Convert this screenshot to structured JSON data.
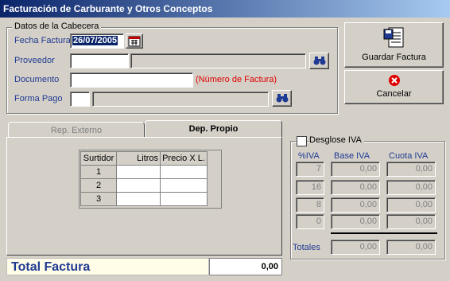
{
  "window": {
    "title": "Facturación de Carburante y Otros Conceptos"
  },
  "header": {
    "group_title": "Datos de la Cabecera",
    "fecha_label": "Fecha Factura",
    "fecha_value": "26/07/2005",
    "proveedor_label": "Proveedor",
    "proveedor_code": "",
    "proveedor_name": "",
    "documento_label": "Documento",
    "documento_value": "",
    "documento_hint": "(Número de Factura)",
    "forma_pago_label": "Forma Pago",
    "forma_pago_code": "",
    "forma_pago_name": ""
  },
  "actions": {
    "save_label": "Guardar Factura",
    "cancel_label": "Cancelar"
  },
  "tabs": [
    {
      "label": "Rep. Externo",
      "active": false
    },
    {
      "label": "Dep. Propio",
      "active": true
    }
  ],
  "surtidor_table": {
    "headers": [
      "Surtidor",
      "Litros",
      "Precio X L."
    ],
    "rows": [
      {
        "surtidor": "1",
        "litros": "",
        "precio": ""
      },
      {
        "surtidor": "2",
        "litros": "",
        "precio": ""
      },
      {
        "surtidor": "3",
        "litros": "",
        "precio": ""
      }
    ]
  },
  "iva": {
    "group_title": "Desglose IVA",
    "checked": false,
    "headers": {
      "pct": "%IVA",
      "base": "Base IVA",
      "cuota": "Cuota IVA"
    },
    "rows": [
      {
        "pct": "7",
        "base": "0,00",
        "cuota": "0,00"
      },
      {
        "pct": "16",
        "base": "0,00",
        "cuota": "0,00"
      },
      {
        "pct": "8",
        "base": "0,00",
        "cuota": "0,00"
      },
      {
        "pct": "0",
        "base": "0,00",
        "cuota": "0,00"
      }
    ],
    "totals_label": "Totales",
    "total_base": "0,00",
    "total_cuota": "0,00"
  },
  "total": {
    "label": "Total Factura",
    "value": "0,00"
  },
  "colors": {
    "titlebar_start": "#0a246a",
    "titlebar_end": "#a6caf0",
    "label_blue": "#1f3a93",
    "hint_red": "#e00000",
    "total_bg": "#fffce8"
  },
  "icons": {
    "calendar": "calendar-icon",
    "search": "binoculars-icon",
    "save": "save-document-icon",
    "cancel": "cancel-icon"
  }
}
